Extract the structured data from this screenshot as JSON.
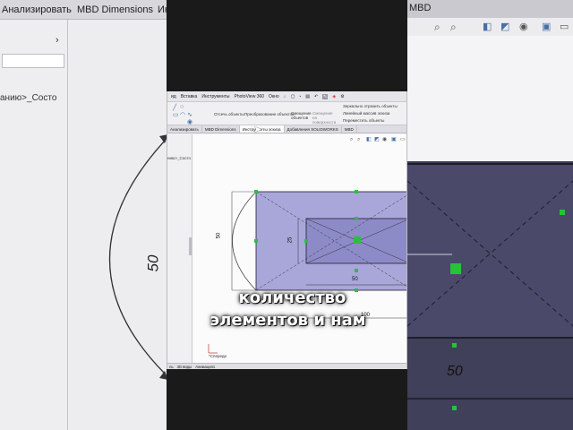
{
  "background": {
    "tabs": [
      "Анализировать",
      "MBD Dimensions",
      "Ин"
    ],
    "right_tab": "MBD",
    "breadcrumb": "анию>_Состо",
    "dimension_50_vertical": "50",
    "dimension_50_horizontal": "50"
  },
  "app": {
    "menu": [
      "ид",
      "Вставка",
      "Инструменты",
      "PhotoView 360",
      "Окно"
    ],
    "ribbon": {
      "offset": "Отсечь объекты",
      "convert": "Преобразование объектов",
      "offset_entities": "Смещение объектов",
      "equal": "Смещение на поверхности",
      "mirror": "Зеркально отразить объекты",
      "linear": "Линейный массив эскиза",
      "move": "Переместить объекты"
    },
    "command_tabs": [
      "Анализировать",
      "MBD Dimensions",
      "Инструменты эскиза",
      "Добавления SOLIDWORKS",
      "MBD"
    ],
    "active_tab_index": 2,
    "tree_label": "нию>_Состо",
    "bottom_tabs": [
      "ль",
      "3D виды",
      "Анимация1"
    ],
    "view_label": "*Спереди",
    "dims": {
      "left_arc": "50",
      "inner_height": "25",
      "inner_width": "50",
      "total_width": "100"
    }
  },
  "subtitle": {
    "line1": "количество",
    "line2": "элементов и нам"
  },
  "colors": {
    "rect_fill": "#a9a6d9",
    "inner_fill": "#8d8ac8",
    "point": "#27c23a"
  }
}
